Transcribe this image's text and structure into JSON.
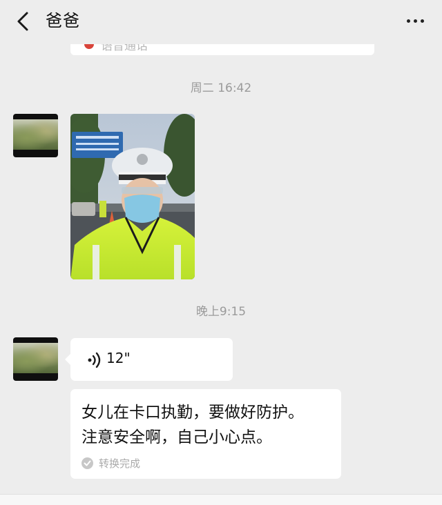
{
  "header": {
    "title": "爸爸",
    "back_icon": "chevron-left-icon",
    "more_icon": "more-dots-icon"
  },
  "previous_message": {
    "text": "语音通话"
  },
  "messages": [
    {
      "timestamp": "周二 16:42",
      "sender": "爸爸",
      "type": "image",
      "image_description_icon": "photo-icon"
    },
    {
      "timestamp": "晚上9:15",
      "sender": "爸爸",
      "type": "voice",
      "duration": "12\"",
      "transcription": {
        "line1": "女儿在卡口执勤，要做好防护。",
        "line2": "注意安全啊，自己小心点。",
        "status": "转换完成"
      }
    }
  ],
  "colors": {
    "background": "#ededed",
    "bubble": "#ffffff",
    "timestamp_text": "#9a9a9a",
    "status_text": "#aaaaaa"
  }
}
